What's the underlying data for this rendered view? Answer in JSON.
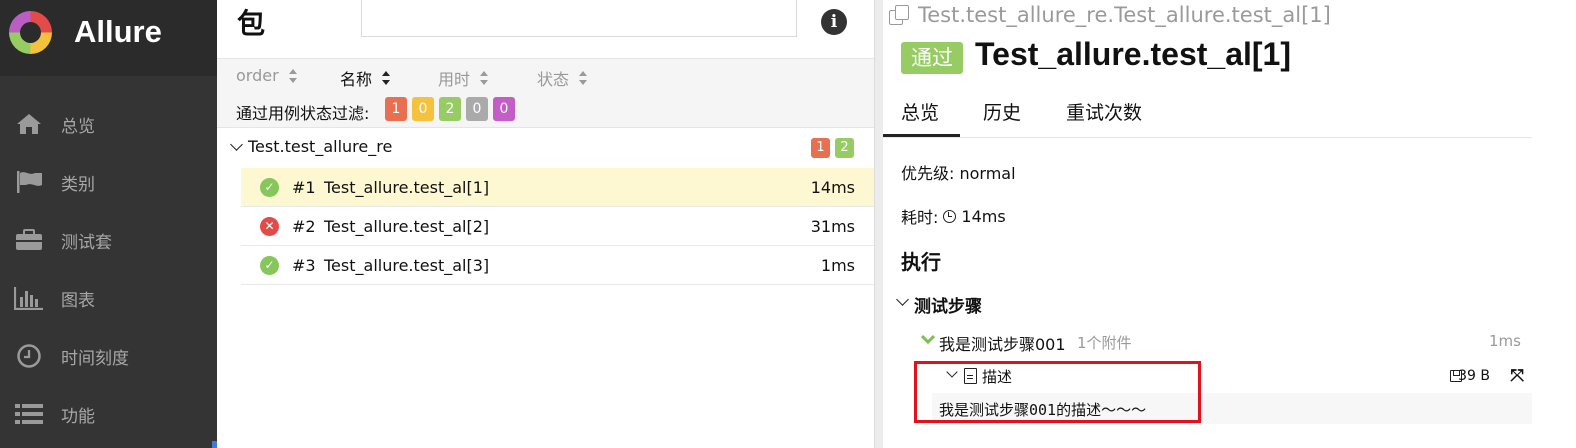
{
  "app": {
    "name": "Allure"
  },
  "sidebar": {
    "items": [
      {
        "label": "总览",
        "icon": "home-icon"
      },
      {
        "label": "类别",
        "icon": "flag-icon"
      },
      {
        "label": "测试套",
        "icon": "briefcase-icon"
      },
      {
        "label": "图表",
        "icon": "bar-chart-icon"
      },
      {
        "label": "时间刻度",
        "icon": "clock-icon"
      },
      {
        "label": "功能",
        "icon": "list-icon"
      }
    ]
  },
  "list": {
    "title": "包",
    "search_value": "",
    "info_icon": "i",
    "sort": [
      {
        "label": "order",
        "active": false
      },
      {
        "label": "名称",
        "active": true
      },
      {
        "label": "用时",
        "active": false
      },
      {
        "label": "状态",
        "active": false
      }
    ],
    "filter_label": "通过用例状态过滤:",
    "filters": [
      {
        "value": "1",
        "color": "#e86f4f"
      },
      {
        "value": "0",
        "color": "#f5c23d"
      },
      {
        "value": "2",
        "color": "#97cc64"
      },
      {
        "value": "0",
        "color": "#aaaaaa"
      },
      {
        "value": "0",
        "color": "#c35ec7"
      }
    ],
    "group": {
      "name": "Test.test_allure_re",
      "failed": "1",
      "passed": "2"
    },
    "tests": [
      {
        "num": "#1",
        "name": "Test_allure.test_al[1]",
        "duration": "14ms",
        "status": "passed"
      },
      {
        "num": "#2",
        "name": "Test_allure.test_al[2]",
        "duration": "31ms",
        "status": "failed"
      },
      {
        "num": "#3",
        "name": "Test_allure.test_al[3]",
        "duration": "1ms",
        "status": "passed"
      }
    ]
  },
  "detail": {
    "breadcrumb": "Test.test_allure_re.Test_allure.test_al[1]",
    "status_badge": "通过",
    "title": "Test_allure.test_al[1]",
    "tabs": [
      "总览",
      "历史",
      "重试次数"
    ],
    "priority": "优先级: normal",
    "duration_label": "耗时:",
    "duration_value": "14ms",
    "execution_heading": "执行",
    "steps_heading": "测试步骤",
    "step": {
      "name": "我是测试步骤001",
      "attachments": "1个附件",
      "duration": "1ms"
    },
    "attachment": {
      "name": "描述",
      "size": "39 B",
      "content": "我是测试步骤001的描述～～～"
    }
  },
  "colors": {
    "sidebar": "#343434",
    "pass": "#97cc64",
    "fail": "#e24b47",
    "highlight": "#e3111b",
    "selected_row": "#fdf8d2"
  }
}
